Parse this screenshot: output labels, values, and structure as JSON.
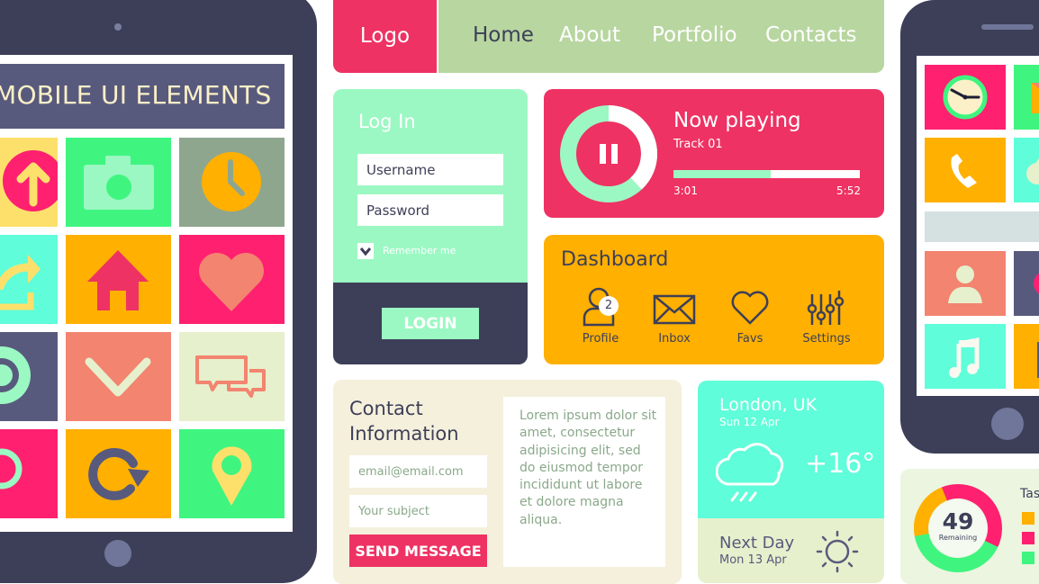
{
  "colors": {
    "navy": "#3d3f58",
    "pink": "#ee3263",
    "mint": "#9bf8c3",
    "aqua": "#5ffdd9",
    "amber": "#ffb000",
    "sage": "#b8d6a0",
    "cream": "#f5f0dc",
    "coral": "#f28470",
    "green": "#3ff57f"
  },
  "tablet": {
    "header_title": "MOBILE UI ELEMENTS",
    "tiles": [
      {
        "icon": "arrow-up-circle-icon"
      },
      {
        "icon": "camera-icon"
      },
      {
        "icon": "clock-icon"
      },
      {
        "icon": "share-icon"
      },
      {
        "icon": "home-icon"
      },
      {
        "icon": "heart-icon"
      },
      {
        "icon": "gear-icon"
      },
      {
        "icon": "chevron-down-icon"
      },
      {
        "icon": "chat-bubbles-icon"
      },
      {
        "icon": "ring-icon"
      },
      {
        "icon": "refresh-icon"
      },
      {
        "icon": "map-pin-icon"
      }
    ]
  },
  "nav": {
    "logo": "Logo",
    "items": [
      {
        "label": "Home",
        "active": true
      },
      {
        "label": "About",
        "active": false
      },
      {
        "label": "Portfolio",
        "active": false
      },
      {
        "label": "Contacts",
        "active": false
      }
    ]
  },
  "login": {
    "title": "Log In",
    "username_placeholder": "Username",
    "password_placeholder": "Password",
    "remember_label": "Remember me",
    "remember_checked": true,
    "button_label": "LOGIN"
  },
  "player": {
    "title": "Now playing",
    "track": "Track 01",
    "current_time": "3:01",
    "total_time": "5:52",
    "progress_fraction": 0.52,
    "button": "pause"
  },
  "dashboard": {
    "title": "Dashboard",
    "items": [
      {
        "label": "Profile",
        "icon": "profile-icon",
        "badge": "2"
      },
      {
        "label": "Inbox",
        "icon": "envelope-icon"
      },
      {
        "label": "Favs",
        "icon": "heart-outline-icon"
      },
      {
        "label": "Settings",
        "icon": "sliders-icon"
      }
    ]
  },
  "contact": {
    "title_line1": "Contact",
    "title_line2": "Information",
    "email_placeholder": "email@email.com",
    "subject_placeholder": "Your subject",
    "send_label": "SEND MESSAGE",
    "message": "Lorem ipsum dolor sit amet, consectetur adipisicing elit, sed do eiusmod tempor incididunt ut labore et dolore magna aliqua."
  },
  "weather": {
    "city": "London, UK",
    "date": "Sun 12 Apr",
    "temperature": "+16°",
    "condition_icon": "rain-cloud-icon",
    "next_label": "Next Day",
    "next_date": "Mon 13 Apr",
    "next_icon": "sun-icon"
  },
  "phone": {
    "tiles": [
      {
        "icon": "clock-icon"
      },
      {
        "icon": "envelope-icon"
      },
      {
        "icon": "phone-icon"
      },
      {
        "icon": "cloud-icon"
      },
      {
        "icon": "contact-icon"
      },
      {
        "icon": "circle-icon"
      },
      {
        "icon": "music-icon"
      },
      {
        "icon": "box-icon"
      }
    ]
  },
  "tasks": {
    "remaining": "49",
    "remaining_label": "Remaining",
    "title": "Tas",
    "segments": [
      {
        "color": "#ffb000",
        "fraction": 0.22
      },
      {
        "color": "#ff2070",
        "fraction": 0.38
      },
      {
        "color": "#3ff57f",
        "fraction": 0.4
      }
    ]
  }
}
